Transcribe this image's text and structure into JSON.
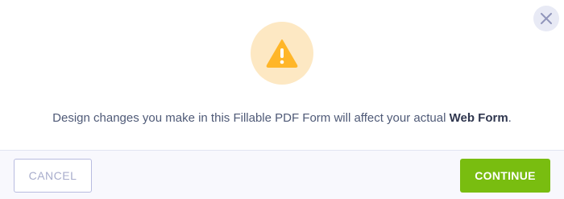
{
  "dialog": {
    "close_icon": "close-icon",
    "warning_icon": "warning-triangle-icon",
    "message_prefix": "Design changes you make in this Fillable PDF Form will affect your actual ",
    "message_emphasis": "Web Form",
    "message_suffix": "."
  },
  "footer": {
    "cancel_label": "CANCEL",
    "continue_label": "CONTINUE"
  },
  "colors": {
    "accent_green": "#79bd10",
    "warning_orange": "#ffb629",
    "warning_bg": "#fde8c3",
    "text": "#4f5a77"
  }
}
